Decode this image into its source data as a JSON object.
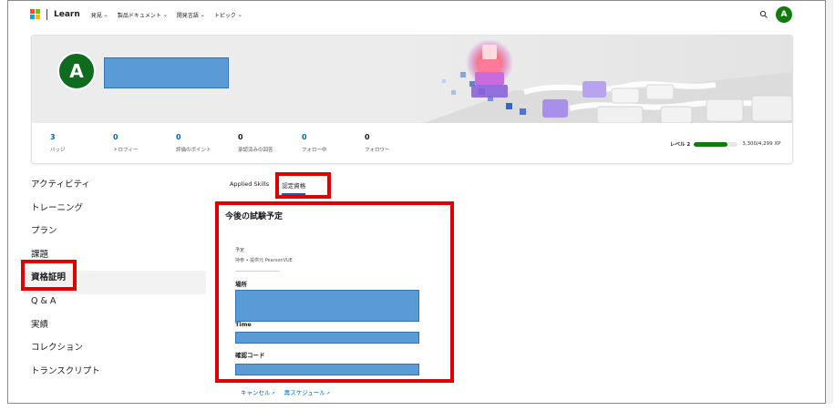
{
  "nav": {
    "brand": "Learn",
    "items": [
      "発見",
      "製品ドキュメント",
      "開発言語",
      "トピック"
    ],
    "avatar_initial": "A",
    "logo_colors": [
      "#f25022",
      "#7fba00",
      "#00a4ef",
      "#ffb900"
    ]
  },
  "profile": {
    "avatar_initial": "A",
    "stats": [
      {
        "value": "3",
        "label": "バッジ"
      },
      {
        "value": "0",
        "label": "トロフィー"
      },
      {
        "value": "0",
        "label": "評価のポイント"
      },
      {
        "value": "0",
        "label": "承認済みの回答"
      },
      {
        "value": "0",
        "label": "フォロー中"
      },
      {
        "value": "0",
        "label": "フォロワー"
      }
    ],
    "level": {
      "label": "レベル 2",
      "xp": "3,300/4,299 XP",
      "progress": 0.77
    }
  },
  "sidebar": {
    "items": [
      "アクティビティ",
      "トレーニング",
      "プラン",
      "課題",
      "資格証明",
      "Q & A",
      "実績",
      "コレクション",
      "トランスクリプト"
    ],
    "active_index": 4
  },
  "tabs": {
    "items": [
      "Applied Skills",
      "認定資格"
    ],
    "active_index": 1
  },
  "exam": {
    "title": "今後の試験予定",
    "scheduled_label": "予定",
    "scheduled_sub": "持参 • 提供元 PearsonVUE",
    "location_label": "場所",
    "time_label": "Time",
    "confirmation_label": "確認コード",
    "cancel_link": "キャンセル",
    "reschedule_link": "再スケジュール"
  },
  "colors": {
    "accent": "#0067b8",
    "highlight": "#e00000",
    "redaction": "#5b9bd5",
    "avatar": "#107c10"
  }
}
